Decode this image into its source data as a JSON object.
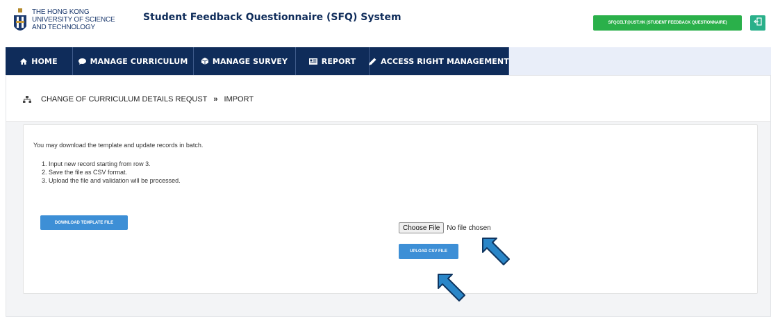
{
  "header": {
    "org_lines": [
      "THE HONG KONG",
      "UNIVERSITY OF SCIENCE",
      "AND TECHNOLOGY"
    ],
    "app_title": "Student Feedback Questionnaire (SFQ) System",
    "user_label": "SFQCELT@UST.HK (STUDENT FEEDBACK QUESTIONNAIRE)",
    "logout_icon": "logout-icon"
  },
  "nav": {
    "items": [
      {
        "label": "HOME",
        "icon": "home-icon"
      },
      {
        "label": "MANAGE CURRICULUM",
        "icon": "comment-icon"
      },
      {
        "label": "MANAGE SURVEY",
        "icon": "cube-icon"
      },
      {
        "label": "REPORT",
        "icon": "report-icon"
      },
      {
        "label": "ACCESS RIGHT MANAGEMENT",
        "icon": "pencil-icon"
      }
    ]
  },
  "breadcrumb": {
    "icon": "sitemap-icon",
    "parent": "CHANGE OF CURRICULUM DETAILS REQUST",
    "separator": "»",
    "current": "IMPORT"
  },
  "panel": {
    "intro": "You may download the template and update records in batch.",
    "steps": [
      "1. Input new record starting from row 3.",
      "2. Save the file as CSV format.",
      "3. Upload the file and validation will be processed."
    ],
    "download_label": "DOWNLOAD TEMPLATE FILE",
    "choose_label": "Choose File",
    "file_status": "No file chosen",
    "upload_label": "UPLOAD CSV FILE"
  },
  "colors": {
    "nav_bg": "#0f2c5a",
    "user_badge": "#2ab04a",
    "logout_btn": "#2ab08a",
    "primary_button": "#3d8fd6",
    "annotation_arrow": "#2a86c8"
  }
}
